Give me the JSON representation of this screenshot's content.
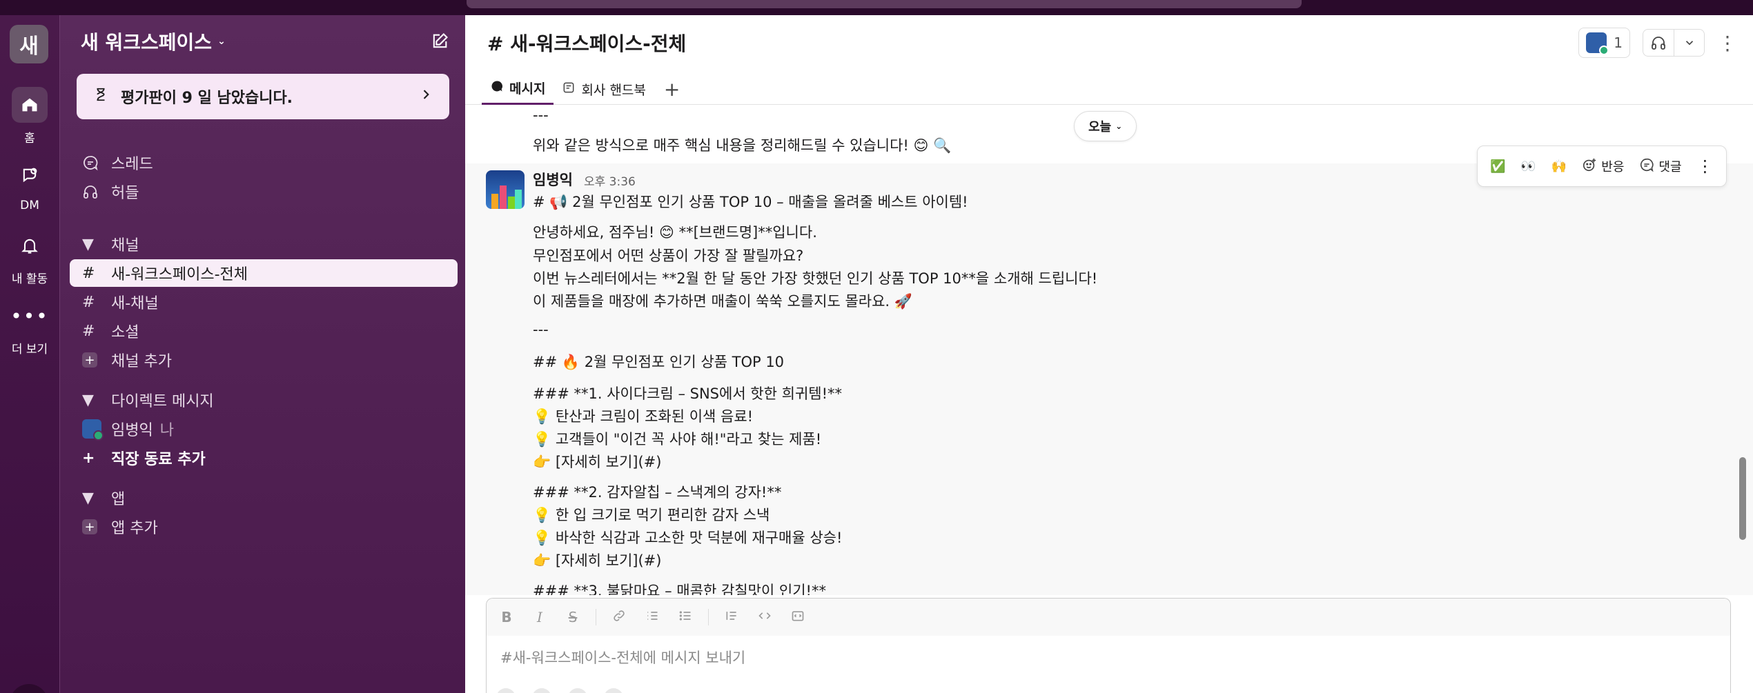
{
  "rail": {
    "workspace_initial": "새",
    "items": [
      {
        "label": "홈",
        "icon": "home-icon"
      },
      {
        "label": "DM",
        "icon": "dm-icon"
      },
      {
        "label": "내 활동",
        "icon": "bell-icon"
      },
      {
        "label": "더 보기",
        "icon": "more-icon"
      }
    ]
  },
  "sidebar": {
    "workspace_name": "새 워크스페이스",
    "trial_banner": "평가판이 9 일 남았습니다.",
    "nav": [
      {
        "label": "스레드",
        "icon": "threads-icon"
      },
      {
        "label": "허들",
        "icon": "headphones-icon"
      }
    ],
    "channels_header": "채널",
    "channels": [
      "새-워크스페이스-전체",
      "새-채널",
      "소셜"
    ],
    "add_channel": "채널 추가",
    "dm_header": "다이렉트 메시지",
    "dm_user": "임병익",
    "dm_user_suffix": "나",
    "add_coworker": "직장 동료 추가",
    "apps_header": "앱",
    "add_app": "앱 추가"
  },
  "header": {
    "channel_title": "# 새-워크스페이스-전체",
    "member_count": "1",
    "tabs": [
      {
        "label": "메시지",
        "icon": "message-icon"
      },
      {
        "label": "회사 핸드북",
        "icon": "canvas-icon"
      }
    ]
  },
  "messages": {
    "today_label": "오늘",
    "prev_lines": [
      "---",
      "위와 같은 방식으로 매주 핵심 내용을 정리해드릴 수 있습니다! 😊 🔍"
    ],
    "author": "임병익",
    "time": "오후 3:36",
    "body": [
      "# 📢 2월 무인점포 인기 상품 TOP 10 – 매출을 올려줄 베스트 아이템!",
      "안녕하세요, 점주님! 😊 **[브랜드명]**입니다.",
      "무인점포에서 어떤 상품이 가장 잘 팔릴까요?",
      "이번 뉴스레터에서는 **2월 한 달 동안 가장 핫했던 인기 상품 TOP 10**을 소개해 드립니다!",
      "이 제품들을 매장에 추가하면 매출이 쑥쑥 오를지도 몰라요. 🚀",
      "---",
      "## 🔥 2월 무인점포 인기 상품 TOP 10",
      "### **1. 사이다크림 – SNS에서 핫한 희귀템!**",
      "💡 탄산과 크림이 조화된 이색 음료!",
      "💡 고객들이 \"이건 꼭 사야 해!\"라고 찾는 제품!",
      "👉 [자세히 보기](#)",
      "### **2. 감자알칩 – 스낵계의 강자!**",
      "💡 한 입 크기로 먹기 편리한 감자 스낵",
      "💡 바삭한 식감과 고소한 맛 덕분에 재구매율 상승!",
      "👉 [자세히 보기](#)",
      "### **3. 불닭마요 – 매콤한 감칠맛이 인기!**"
    ],
    "toolbar": {
      "check": "✅",
      "eyes": "👀",
      "hands": "🙌",
      "react_label": "반응",
      "reply_label": "댓글"
    }
  },
  "composer": {
    "placeholder": "#새-워크스페이스-전체에 메시지 보내기"
  },
  "colors": {
    "sidebar": "#4a1a4c",
    "active_channel_bg": "#f8edf7",
    "accent": "#611f69",
    "online": "#2bac76"
  }
}
